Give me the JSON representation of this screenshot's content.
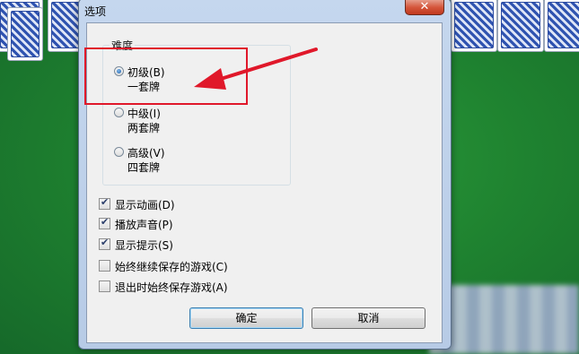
{
  "window": {
    "title": "选项",
    "close_glyph": "✕"
  },
  "difficulty": {
    "group_label": "难度",
    "options": [
      {
        "label": "初级(B)",
        "sub": "一套牌",
        "selected": true
      },
      {
        "label": "中级(I)",
        "sub": "两套牌",
        "selected": false
      },
      {
        "label": "高级(V)",
        "sub": "四套牌",
        "selected": false
      }
    ]
  },
  "settings": [
    {
      "label": "显示动画(D)",
      "checked": true
    },
    {
      "label": "播放声音(P)",
      "checked": true
    },
    {
      "label": "显示提示(S)",
      "checked": true
    },
    {
      "label": "始终继续保存的游戏(C)",
      "checked": false
    },
    {
      "label": "退出时始终保存游戏(A)",
      "checked": false
    }
  ],
  "buttons": {
    "ok": "确定",
    "cancel": "取消"
  },
  "annotation": {
    "color": "#e0182a"
  },
  "icons": {
    "close": "close-icon",
    "checkmark": "checkmark-icon",
    "arrow": "arrow-icon"
  }
}
